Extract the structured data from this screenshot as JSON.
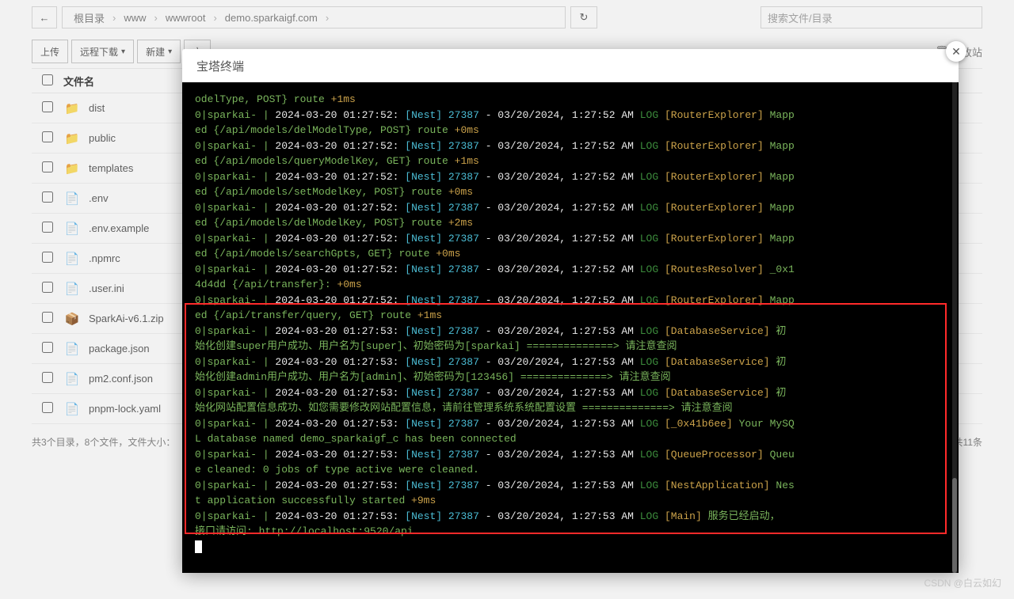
{
  "breadcrumb": {
    "root": "根目录",
    "p1": "www",
    "p2": "wwwroot",
    "p3": "demo.sparkaigf.com"
  },
  "search": {
    "placeholder": "搜索文件/目录"
  },
  "actions": {
    "upload": "上传",
    "remote": "远程下载",
    "new": "新建",
    "file": "文",
    "recycle": "回收站"
  },
  "table": {
    "header": "文件名"
  },
  "files": [
    {
      "name": "dist",
      "icon": "folder"
    },
    {
      "name": "public",
      "icon": "folder"
    },
    {
      "name": "templates",
      "icon": "folder"
    },
    {
      "name": ".env",
      "icon": "file"
    },
    {
      "name": ".env.example",
      "icon": "file"
    },
    {
      "name": ".npmrc",
      "icon": "file"
    },
    {
      "name": ".user.ini",
      "icon": "file"
    },
    {
      "name": "SparkAi-v6.1.zip",
      "icon": "zip"
    },
    {
      "name": "package.json",
      "icon": "json"
    },
    {
      "name": "pm2.conf.json",
      "icon": "json"
    },
    {
      "name": "pnpm-lock.yaml",
      "icon": "file"
    }
  ],
  "footer": {
    "left": "共3个目录，8个文件，文件大小：",
    "right": "共11条"
  },
  "modal": {
    "title": "宝塔终端"
  },
  "term": {
    "l0a": "odelType, POST} route ",
    "l0b": "+1ms",
    "prefix": "0|sparkai- | ",
    "ts52": "2024-03-20 01:27:52:",
    "ts53": "2024-03-20 01:27:53:",
    "nest": "[Nest] 27387",
    "dash": "  -  ",
    "date52": "03/20/2024, 1:27:52 AM",
    "date53": "03/20/2024, 1:27:53 AM",
    "log": "LOG ",
    "re": "[RouterExplorer]",
    "rr": "[RoutesResolver]",
    "db": "[DatabaseService]",
    "mysql": "[_0x41b6ee]",
    "qp": "[QueueProcessor]",
    "na": "[NestApplication]",
    "main": "[Main]",
    "map": " Mapp",
    "ed1": "ed {/api/models/delModelType, POST} route ",
    "p0": "+0ms",
    "ed2": "ed {/api/models/queryModelKey, GET} route ",
    "p1": "+1ms",
    "ed3": "ed {/api/models/setModelKey, POST} route ",
    "ed4": "ed {/api/models/delModelKey, POST} route ",
    "p2": "+2ms",
    "ed5": "ed {/api/models/searchGpts, GET} route ",
    "rr_tail": " _0x1",
    "rr_l2": "4d4dd {/api/transfer}: ",
    "ed6": "ed {/api/transfer/query, GET} route ",
    "db_tail": " 初",
    "db_l1": "始化创建super用户成功、用户名为[super]、初始密码为[sparkai] ==============> 请注意查阅",
    "db_l2": "始化创建admin用户成功、用户名为[admin]、初始密码为[123456] ==============> 请注意查阅",
    "db_l3": "始化网站配置信息成功、如您需要修改网站配置信息，请前往管理系统系统配置设置 ==============> 请注意查阅",
    "mysql_t": " Your MySQ",
    "mysql2": "L database named demo_sparkaigf_c has been connected",
    "qp_t": " Queu",
    "qp2": "e cleaned: 0 jobs of type active were cleaned.",
    "na_t": " Nes",
    "na2": "t application successfully started ",
    "p9": "+9ms",
    "main_t": " 服务已经启动，",
    "main2": "接口请访问: http://localhost:9520/api"
  },
  "watermark": "CSDN @白云如幻"
}
